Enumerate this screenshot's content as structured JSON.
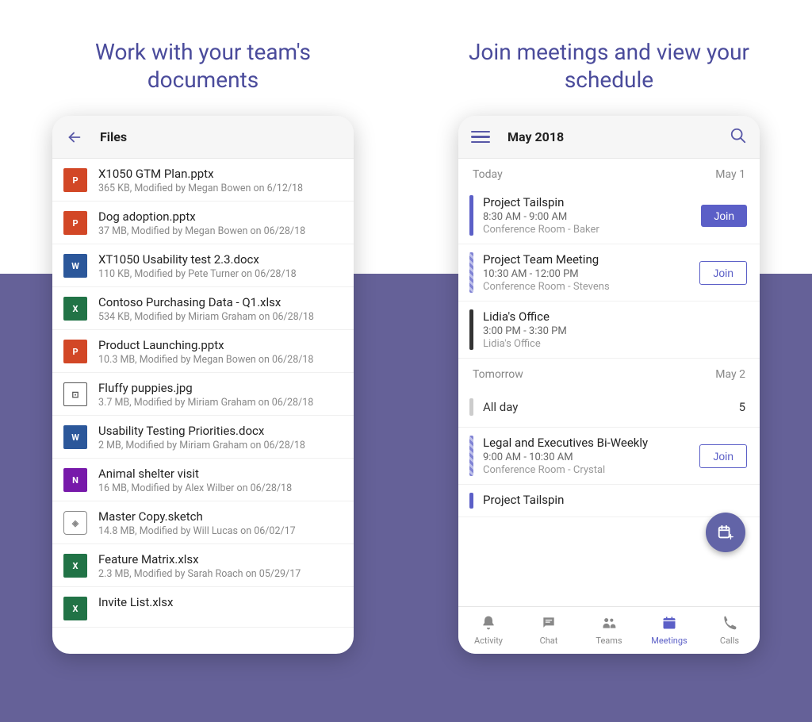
{
  "left": {
    "headline": "Work with your team's documents",
    "header_title": "Files",
    "files": [
      {
        "icon": "pptx",
        "glyph": "P",
        "name": "X1050 GTM Plan.pptx",
        "meta": "365 KB,  Modified by  Megan Bowen  on 6/12/18"
      },
      {
        "icon": "pptx",
        "glyph": "P",
        "name": "Dog adoption.pptx",
        "meta": "37 MB,  Modified by  Megan Bowen  on 06/28/18"
      },
      {
        "icon": "docx",
        "glyph": "W",
        "name": "XT1050 Usability test 2.3.docx",
        "meta": "110 KB,  Modified by  Pete Turner  on 06/28/18"
      },
      {
        "icon": "xlsx",
        "glyph": "X",
        "name": "Contoso Purchasing Data - Q1.xlsx",
        "meta": "534 KB,  Modified by  Miriam Graham  on 06/28/18"
      },
      {
        "icon": "pptx",
        "glyph": "P",
        "name": "Product Launching.pptx",
        "meta": "10.3 MB,  Modified by  Megan Bowen  on 06/28/18"
      },
      {
        "icon": "img",
        "glyph": "⊡",
        "name": "Fluffy puppies.jpg",
        "meta": "3.7 MB,  Modified by  Miriam Graham  on 06/28/18"
      },
      {
        "icon": "docx",
        "glyph": "W",
        "name": "Usability Testing Priorities.docx",
        "meta": "2 MB,  Modified by  Miriam Graham  on 06/28/18"
      },
      {
        "icon": "note",
        "glyph": "N",
        "name": "Animal shelter visit",
        "meta": "16 MB,  Modified by  Alex Wilber  on 06/28/18"
      },
      {
        "icon": "sketch",
        "glyph": "◈",
        "name": "Master Copy.sketch",
        "meta": "14.8 MB,  Modified by  Will Lucas  on 06/02/17"
      },
      {
        "icon": "xlsx",
        "glyph": "X",
        "name": "Feature Matrix.xlsx",
        "meta": "2.3 MB,  Modified by  Sarah Roach  on 05/29/17"
      },
      {
        "icon": "xlsx",
        "glyph": "X",
        "name": "Invite List.xlsx",
        "meta": ""
      }
    ]
  },
  "right": {
    "headline": "Join meetings and view your schedule",
    "header_title": "May 2018",
    "today_label": "Today",
    "today_date": "May 1",
    "tomorrow_label": "Tomorrow",
    "tomorrow_date": "May 2",
    "allday_label": "All day",
    "allday_count": "5",
    "join_label": "Join",
    "events_today": [
      {
        "bar": "solid",
        "title": "Project Tailspin",
        "time": "8:30 AM - 9:00 AM",
        "loc": "Conference Room - Baker",
        "join": "filled"
      },
      {
        "bar": "shaded",
        "title": "Project Team Meeting",
        "time": "10:30 AM - 12:00 PM",
        "loc": "Conference Room - Stevens",
        "join": "outline"
      },
      {
        "bar": "dark",
        "title": "Lidia's Office",
        "time": "3:00 PM - 3:30 PM",
        "loc": "Lidia's Office",
        "join": ""
      }
    ],
    "events_tomorrow": [
      {
        "bar": "shaded",
        "title": "Legal and Executives Bi-Weekly",
        "time": "9:00 AM - 10:30 AM",
        "loc": "Conference Room - Crystal",
        "join": "outline"
      },
      {
        "bar": "solid",
        "title": "Project Tailspin",
        "time": "",
        "loc": "",
        "join": ""
      }
    ],
    "tabs": [
      {
        "label": "Activity",
        "icon": "bell"
      },
      {
        "label": "Chat",
        "icon": "chat"
      },
      {
        "label": "Teams",
        "icon": "teams"
      },
      {
        "label": "Meetings",
        "icon": "calendar",
        "active": true
      },
      {
        "label": "Calls",
        "icon": "phone"
      }
    ]
  }
}
